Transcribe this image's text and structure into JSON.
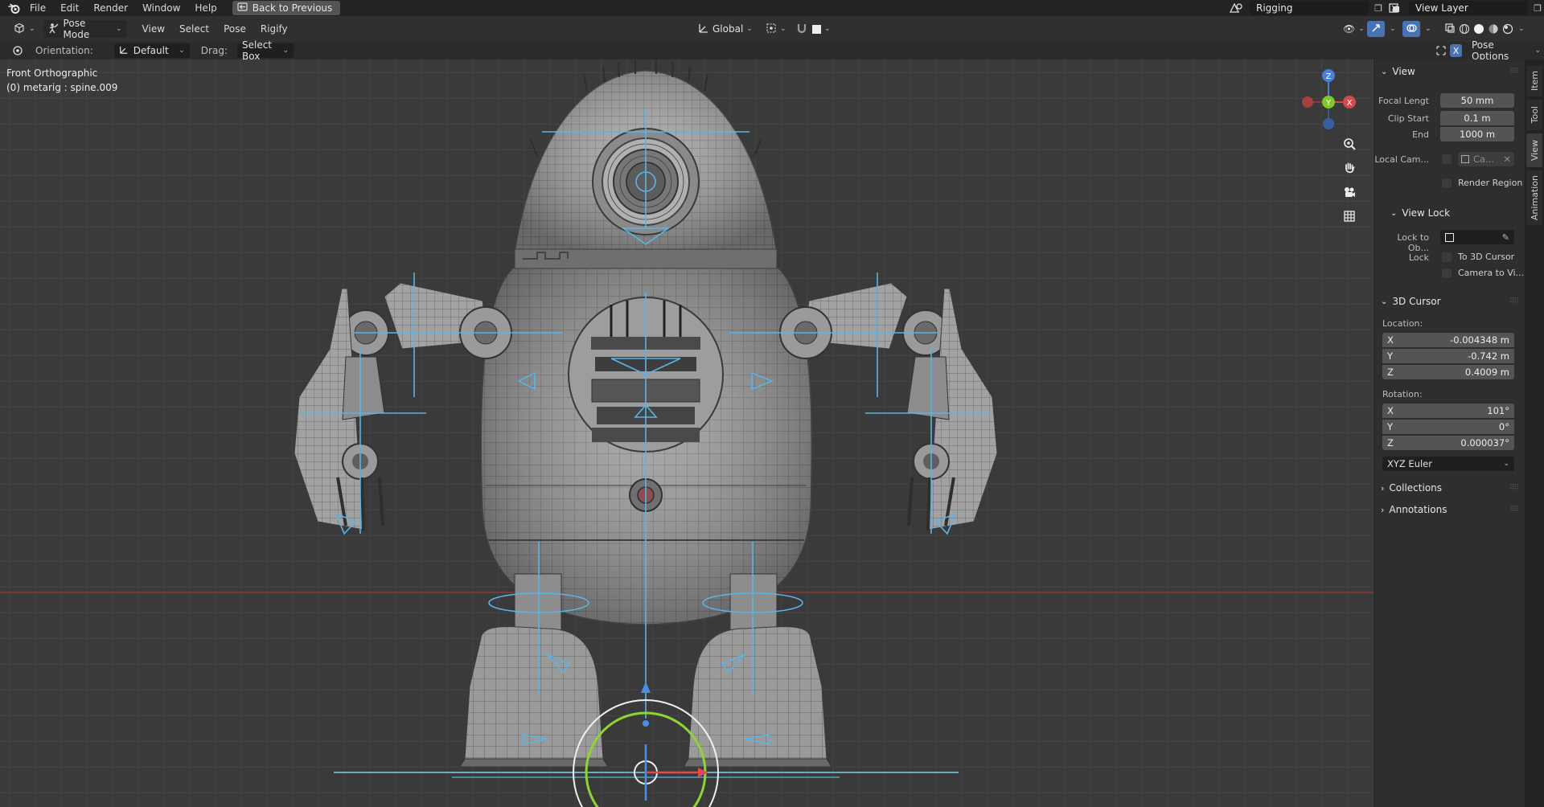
{
  "topbar": {
    "menu": [
      "File",
      "Edit",
      "Render",
      "Window",
      "Help"
    ],
    "back_button": "Back to Previous",
    "scene_name": "Rigging",
    "view_layer": "View Layer"
  },
  "header": {
    "mode": "Pose Mode",
    "menus": [
      "View",
      "Select",
      "Pose",
      "Rigify"
    ],
    "transform_orientation": "Global",
    "pose_options": "Pose Options"
  },
  "tool_settings": {
    "orientation_label": "Orientation:",
    "orientation_value": "Default",
    "drag_label": "Drag:",
    "drag_value": "Select Box"
  },
  "viewport": {
    "view_name": "Front Orthographic",
    "active_object": "(0) metarig : spine.009",
    "gizmo_axes": {
      "x": "X",
      "y": "Y",
      "z": "Z"
    }
  },
  "side_tabs": [
    "Item",
    "Tool",
    "View",
    "Animation"
  ],
  "npanel": {
    "view": {
      "title": "View",
      "focal_label": "Focal Lengt",
      "focal_value": "50 mm",
      "clip_start_label": "Clip Start",
      "clip_start_value": "0.1 m",
      "clip_end_label": "End",
      "clip_end_value": "1000 m",
      "local_camera_label": "Local Cam...",
      "local_camera_value": "Ca...",
      "render_region_label": "Render Region"
    },
    "view_lock": {
      "title": "View Lock",
      "lock_to_object_label": "Lock to Ob...",
      "lock_label": "Lock",
      "to_3d_cursor": "To 3D Cursor",
      "camera_to_view": "Camera to Vi..."
    },
    "cursor": {
      "title": "3D Cursor",
      "location_label": "Location:",
      "location": [
        {
          "axis": "X",
          "value": "-0.004348 m"
        },
        {
          "axis": "Y",
          "value": "-0.742 m"
        },
        {
          "axis": "Z",
          "value": "0.4009 m"
        }
      ],
      "rotation_label": "Rotation:",
      "rotation": [
        {
          "axis": "X",
          "value": "101°"
        },
        {
          "axis": "Y",
          "value": "0°"
        },
        {
          "axis": "Z",
          "value": "0.000037°"
        }
      ],
      "rotation_mode": "XYZ Euler"
    },
    "collections_title": "Collections",
    "annotations_title": "Annotations"
  }
}
